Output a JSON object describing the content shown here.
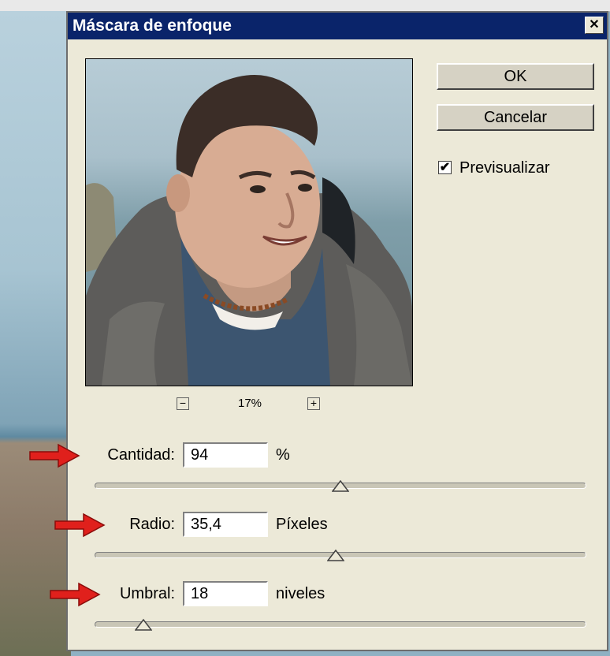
{
  "dialog": {
    "title": "Máscara de enfoque",
    "close_glyph": "✕"
  },
  "preview": {
    "zoom_level": "17%",
    "zoom_out_glyph": "−",
    "zoom_in_glyph": "+"
  },
  "buttons": {
    "ok_label": "OK",
    "cancel_label": "Cancelar"
  },
  "preview_toggle": {
    "label": "Previsualizar",
    "checked": true,
    "check_glyph": "✔"
  },
  "params": {
    "amount": {
      "label": "Cantidad:",
      "value": "94",
      "unit": "%",
      "slider_fraction": 0.5
    },
    "radius": {
      "label": "Radio:",
      "value": "35,4",
      "unit": "Píxeles",
      "slider_fraction": 0.49
    },
    "threshold": {
      "label": "Umbral:",
      "value": "18",
      "unit": "niveles",
      "slider_fraction": 0.1
    }
  },
  "colors": {
    "title_bar": "#0a246a",
    "dialog_bg": "#ece9d8",
    "annotation_arrow": "#e0201c"
  }
}
